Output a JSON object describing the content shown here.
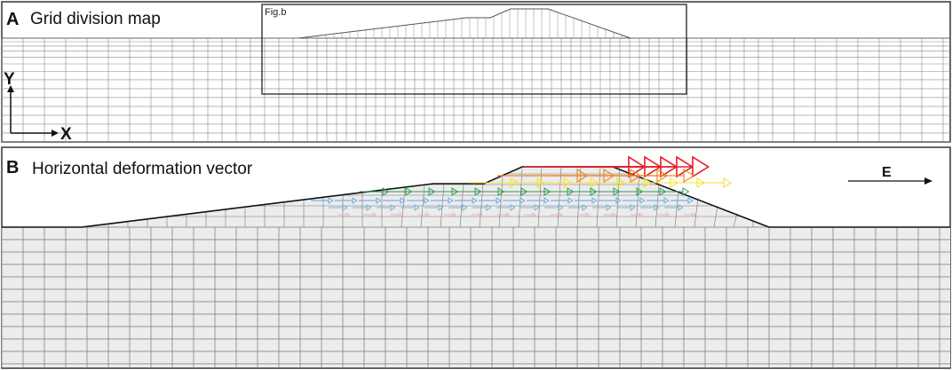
{
  "panel_a": {
    "letter": "A",
    "title": "Grid division map",
    "inset_label": "Fig.b",
    "axis_y": "Y",
    "axis_x": "X"
  },
  "panel_b": {
    "letter": "B",
    "title": "Horizontal deformation vector",
    "direction_label": "E"
  },
  "colors": {
    "frame": "#333333",
    "mesh": "#8a8a8a",
    "slope_fill": "#ececec",
    "vector_red": "#e0202a",
    "vector_orange": "#f08a24",
    "vector_yellow": "#f5e23a",
    "vector_green": "#2e9a55",
    "vector_blue": "#5aa8e0",
    "vector_pink": "#e8a0b4"
  }
}
